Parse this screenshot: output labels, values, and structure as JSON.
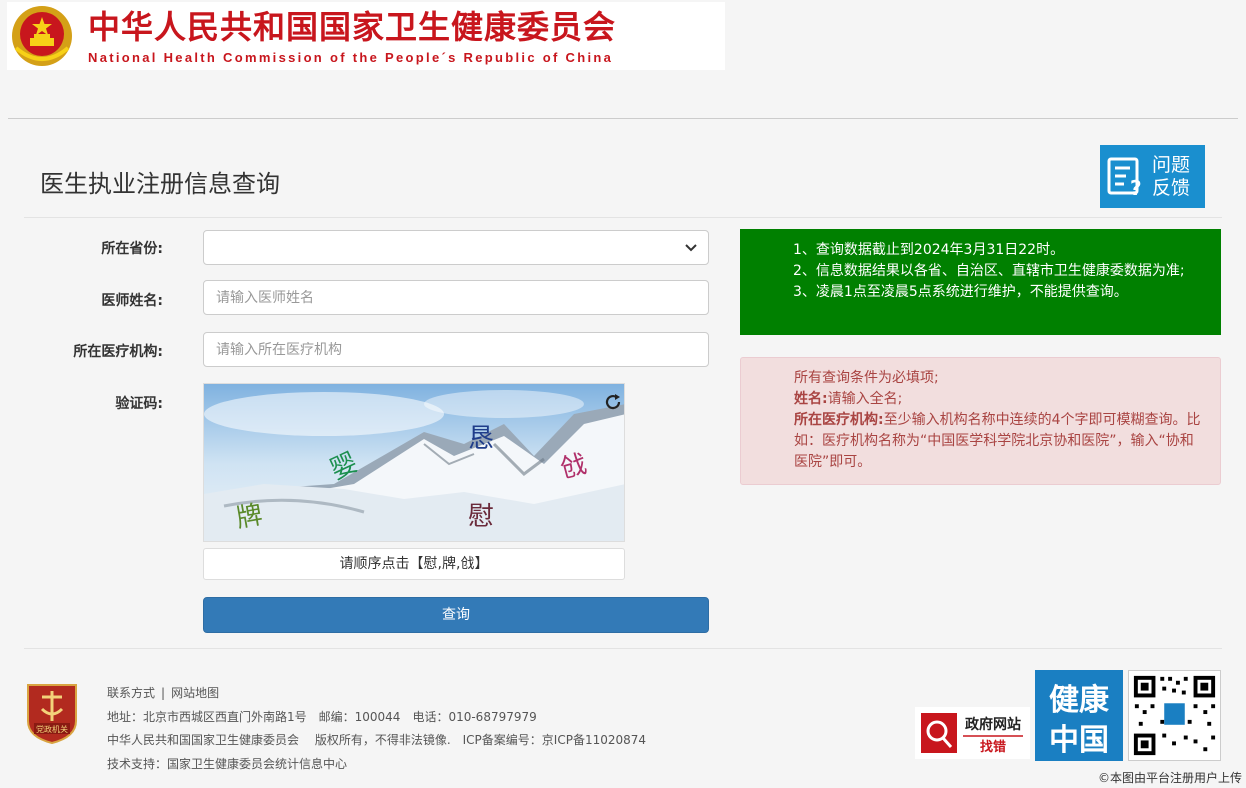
{
  "header": {
    "title_cn": "中华人民共和国国家卫生健康委员会",
    "title_en": "National Health Commission of the People´s Republic of China",
    "emblem_icon": "national-emblem-icon"
  },
  "page": {
    "title": "医生执业注册信息查询",
    "feedback_label_line1": "问题",
    "feedback_label_line2": "反馈"
  },
  "form": {
    "province_label": "所在省份:",
    "province_value": "",
    "name_label": "医师姓名:",
    "name_placeholder": "请输入医师姓名",
    "org_label": "所在医疗机构:",
    "org_placeholder": "请输入所在医疗机构",
    "captcha_label": "验证码:",
    "captcha_chars": [
      "婴",
      "恳",
      "戗",
      "牌",
      "慰"
    ],
    "captcha_hint": "请顺序点击【慰,牌,戗】",
    "submit_label": "查询"
  },
  "notice_info": {
    "line1": "1、查询数据截止到2024年3月31日22时。",
    "line2": "2、信息数据结果以各省、自治区、直辖市卫生健康委数据为准;",
    "line3": "3、凌晨1点至凌晨5点系统进行维护，不能提供查询。",
    "color": "#008000"
  },
  "notice_rules": {
    "line1": "所有查询条件为必填项;",
    "name_key": "姓名:",
    "name_rule": "请输入全名;",
    "org_key": "所在医疗机构:",
    "org_rule": "至少输入机构名称中连续的4个字即可模糊查询。比如：医疗机构名称为“中国医学科学院北京协和医院”，输入“协和医院”即可。"
  },
  "footer": {
    "contact": "联系方式",
    "sitemap": "网站地图",
    "address": "地址：北京市西城区西直门外南路1号　邮编：100044　电话：010-68797979",
    "copyright": "中华人民共和国国家卫生健康委员会　 版权所有，不得非法镜像.　ICP备案编号：京ICP备11020874",
    "support": "技术支持：国家卫生健康委员会统计信息中心",
    "party_badge_text": "党政机关",
    "gov_find_line1": "政府网站",
    "gov_find_line2": "找错",
    "jkzg_line1": "健康",
    "jkzg_line2": "中国"
  },
  "watermark": "©本图由平台注册用户上传"
}
